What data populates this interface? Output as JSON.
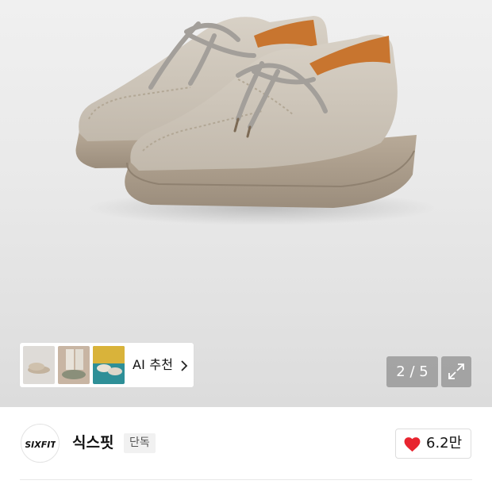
{
  "product_gallery": {
    "image_alt": "Beige suede moc-toe lace-up shoes on crepe soles",
    "current_page": "2",
    "total_pages": "5",
    "page_indicator": "2 / 5",
    "expand_icon": "expand-arrows-icon"
  },
  "ai_recommendation": {
    "label": "AI 추천",
    "icon": "chevron-right-icon",
    "thumbnails": [
      {
        "name": "thumb-beige-suede-shoes",
        "bg": "#d9d6d2"
      },
      {
        "name": "thumb-worn-on-feet",
        "bg": "#c9b6a4"
      },
      {
        "name": "thumb-shoes-on-yellow-teal",
        "bg": "#2e8f97"
      }
    ]
  },
  "brand": {
    "logo_icon": "brand-logo-icon",
    "logo_text": "SIXFIT",
    "name": "식스핏",
    "badge": "단독"
  },
  "like": {
    "icon": "heart-icon",
    "count": "6.2만",
    "color": "#e8242f"
  }
}
